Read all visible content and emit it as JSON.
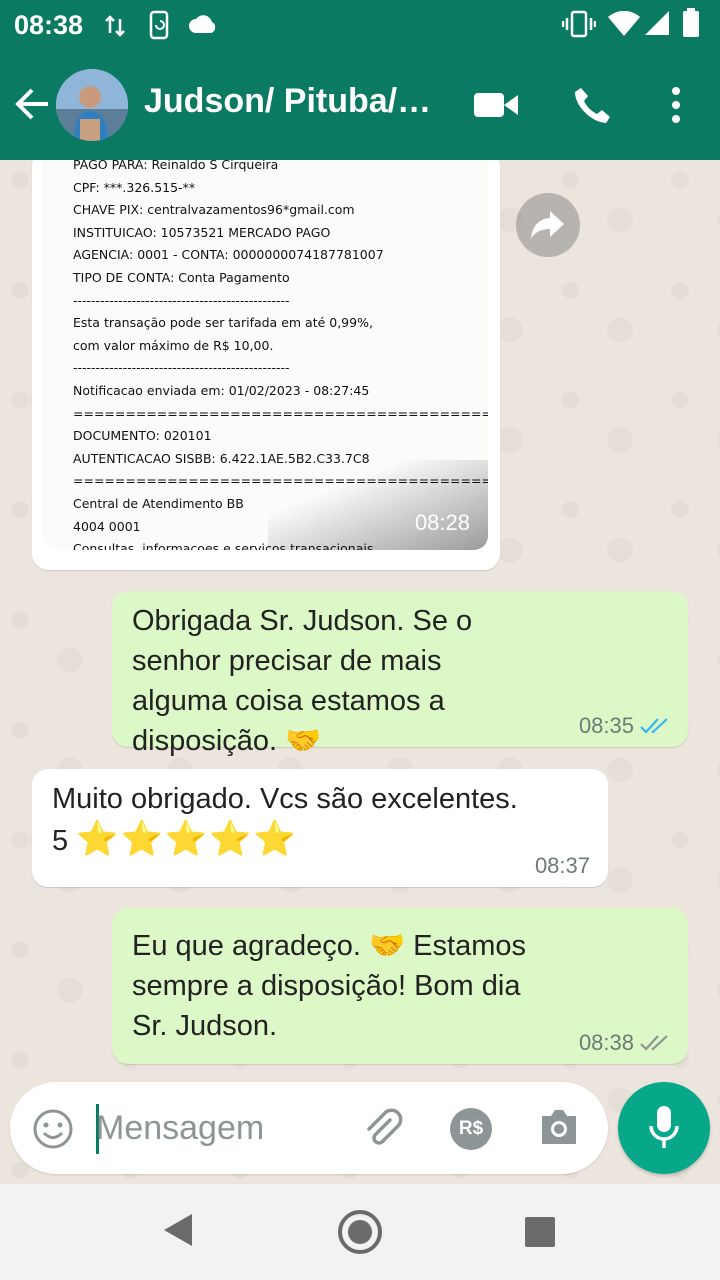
{
  "status_bar": {
    "time": "08:38",
    "icons": [
      "data-arrows-icon",
      "screen-rotate-icon",
      "cloud-icon",
      "vibrate-icon",
      "wifi-icon",
      "signal-icon",
      "battery-icon"
    ]
  },
  "header": {
    "contact_name": "Judson/ Pituba/…",
    "icons": [
      "back-arrow-icon",
      "video-call-icon",
      "phone-icon",
      "more-vert-icon"
    ]
  },
  "colors": {
    "header": "#0b7a63",
    "incoming_bubble": "#ffffff",
    "outgoing_bubble": "#dcf8c6",
    "mic_button": "#07a88a",
    "read_ticks": "#34b7f1"
  },
  "receipt_image": {
    "lines": [
      "PAGO PARA:  Reinaldo S Cirqueira",
      "CPF:  ***.326.515-**",
      "CHAVE PIX: centralvazamentos96*gmail.com",
      "INSTITUICAO: 10573521 MERCADO PAGO",
      "AGENCIA: 0001 - CONTA: 0000000074187781007",
      "TIPO DE CONTA: Conta Pagamento",
      "------------------------------------------------",
      " Esta transação pode ser tarifada em até 0,99%,",
      "        com valor máximo de R$ 10,00.",
      "------------------------------------------------",
      "Notificacao enviada em: 01/02/2023 - 08:27:45",
      "==============================================================",
      "DOCUMENTO: 020101",
      "AUTENTICACAO SISBB:        6.422.1AE.5B2.C33.7C8",
      "==============================================================",
      "Central de Atendimento BB",
      "4004 0001",
      "Consultas, informacoes e servicos transacionais."
    ],
    "time": "08:28"
  },
  "messages": [
    {
      "direction": "out",
      "text": "Obrigada Sr. Judson. Se o senhor precisar de mais alguma coisa estamos a disposição. 🤝",
      "time": "08:35",
      "status": "read"
    },
    {
      "direction": "in",
      "text": "Muito obrigado. Vcs são excelentes. 5 ⭐⭐⭐⭐⭐",
      "time": "08:37"
    },
    {
      "direction": "out",
      "text": "Eu que agradeço. 🤝 Estamos sempre a disposição! Bom dia Sr. Judson.",
      "time": "08:38",
      "status": "delivered"
    }
  ],
  "composer": {
    "placeholder": "Mensagem",
    "icons": [
      "emoji-icon",
      "attach-icon",
      "payment-rs-icon",
      "camera-icon",
      "mic-icon"
    ],
    "payment_label": "R$"
  },
  "nav_bar": {
    "icons": [
      "nav-back-icon",
      "nav-home-icon",
      "nav-recents-icon"
    ]
  }
}
